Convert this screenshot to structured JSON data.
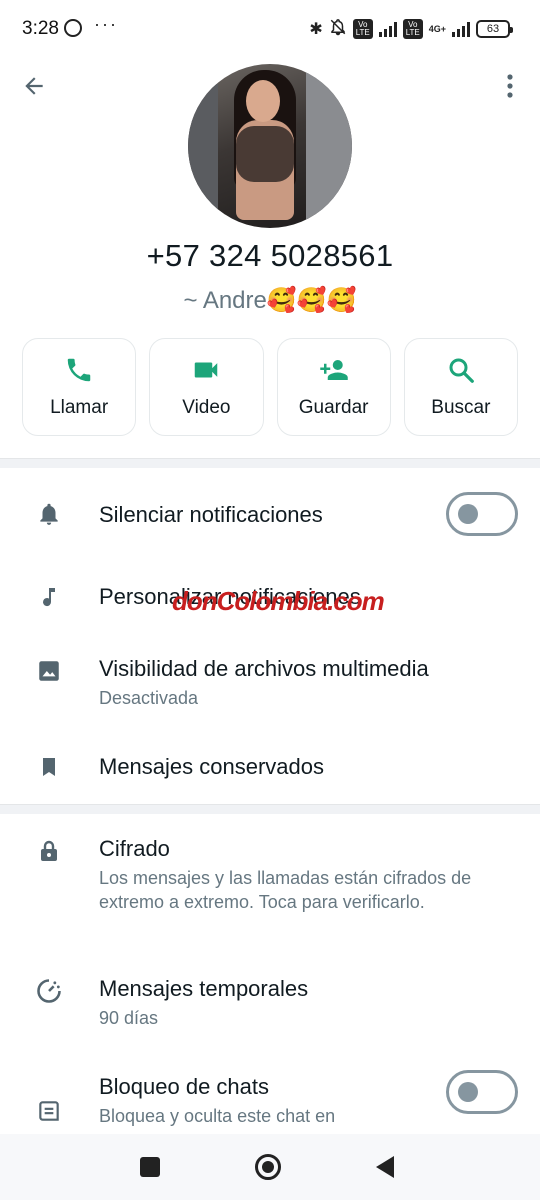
{
  "status_bar": {
    "time": "3:28",
    "dots": "···",
    "volte1": "Vo LTE",
    "volte2": "Vo LTE",
    "network": "4G+",
    "battery": "63"
  },
  "contact": {
    "phone": "+57 324 5028561",
    "push_name": "~ Andre🥰🥰🥰"
  },
  "actions": [
    {
      "label": "Llamar",
      "icon": "phone-icon"
    },
    {
      "label": "Video",
      "icon": "video-icon"
    },
    {
      "label": "Guardar",
      "icon": "add-person-icon"
    },
    {
      "label": "Buscar",
      "icon": "search-icon"
    }
  ],
  "settings": {
    "mute": {
      "title": "Silenciar notificaciones",
      "enabled": false
    },
    "custom_notifications": {
      "title": "Personalizar notificaciones"
    },
    "media_visibility": {
      "title": "Visibilidad de archivos multimedia",
      "subtitle": "Desactivada"
    },
    "kept_messages": {
      "title": "Mensajes conservados"
    },
    "encryption": {
      "title": "Cifrado",
      "subtitle": "Los mensajes y las llamadas están cifrados de extremo a extremo. Toca para verificarlo."
    },
    "disappearing": {
      "title": "Mensajes temporales",
      "subtitle": "90 días"
    },
    "chat_lock": {
      "title": "Bloqueo de chats",
      "subtitle": "Bloquea y oculta este chat en",
      "enabled": false
    }
  },
  "watermark": "donColombia.com",
  "colors": {
    "accent": "#1da57a",
    "icon_gray": "#54656f",
    "subtitle": "#667781"
  }
}
